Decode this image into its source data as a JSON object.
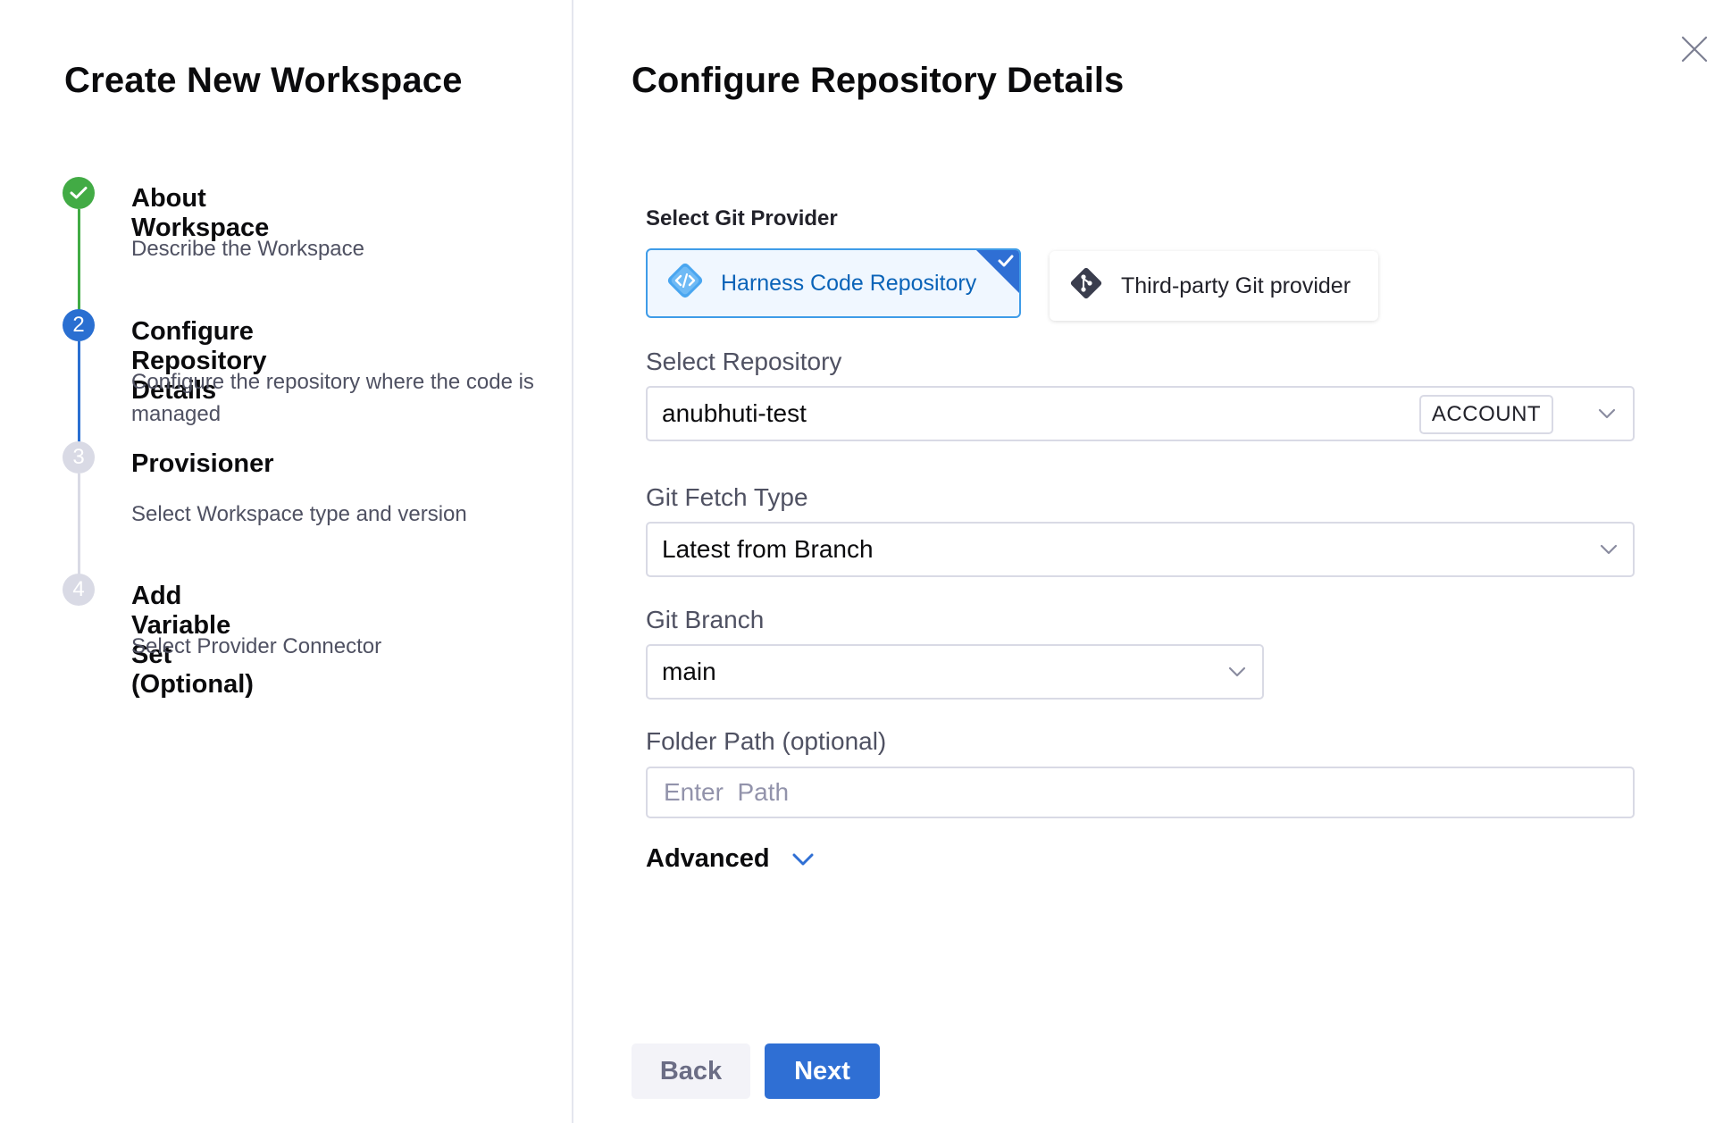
{
  "left_panel": {
    "title": "Create New Workspace",
    "steps": [
      {
        "number": "",
        "title": "About Workspace",
        "description": "Describe the Workspace",
        "state": "done"
      },
      {
        "number": "2",
        "title": "Configure Repository Details",
        "description": "Configure the repository where the code is managed",
        "state": "active"
      },
      {
        "number": "3",
        "title": "Provisioner",
        "description": "Select Workspace type and version",
        "state": "pending"
      },
      {
        "number": "4",
        "title": "Add Variable Set (Optional)",
        "description": "Select Provider Connector",
        "state": "pending"
      }
    ]
  },
  "main": {
    "title": "Configure Repository Details",
    "git_provider": {
      "label": "Select Git Provider",
      "options": [
        {
          "label": "Harness Code Repository",
          "icon": "harness-code-icon",
          "selected": true
        },
        {
          "label": "Third-party Git provider",
          "icon": "git-icon",
          "selected": false
        }
      ]
    },
    "repository": {
      "label": "Select Repository",
      "value": "anubhuti-test",
      "badge": "ACCOUNT"
    },
    "fetch_type": {
      "label": "Git Fetch Type",
      "value": "Latest from Branch"
    },
    "branch": {
      "label": "Git Branch",
      "value": "main"
    },
    "folder_path": {
      "label": "Folder Path (optional)",
      "placeholder": "Enter  Path",
      "value": ""
    },
    "advanced": {
      "label": "Advanced"
    }
  },
  "footer": {
    "back_label": "Back",
    "next_label": "Next"
  },
  "colors": {
    "done": "#42ab45",
    "active": "#2a6fd1",
    "pending": "#d9dae5",
    "accent": "#2f6fd4",
    "selected_border": "#3f9ce8"
  }
}
